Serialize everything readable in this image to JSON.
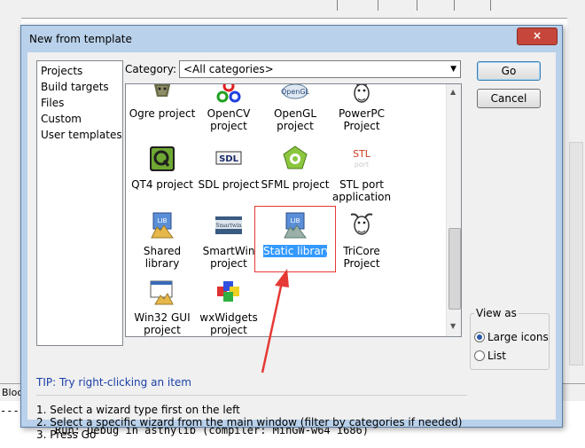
{
  "dialog": {
    "title": "New from template",
    "close": "×"
  },
  "categories_list": [
    "Projects",
    "Build targets",
    "Files",
    "Custom",
    "User templates"
  ],
  "category": {
    "label": "Category:",
    "selected": "<All categories>"
  },
  "templates": [
    {
      "icon": "ogre-icon",
      "label": [
        "Ogre project"
      ]
    },
    {
      "icon": "opencv-icon",
      "label": [
        "OpenCV",
        "project"
      ]
    },
    {
      "icon": "opengl-icon",
      "label": [
        "OpenGL",
        "project"
      ]
    },
    {
      "icon": "powerpc-icon",
      "label": [
        "PowerPC",
        "Project"
      ]
    },
    {
      "icon": "qt-icon",
      "label": [
        "QT4 project"
      ]
    },
    {
      "icon": "sdl-icon",
      "label": [
        "SDL project"
      ]
    },
    {
      "icon": "sfml-icon",
      "label": [
        "SFML project"
      ]
    },
    {
      "icon": "stl-icon",
      "label": [
        "STL port",
        "application"
      ]
    },
    {
      "icon": "lib-icon",
      "label": [
        "Shared",
        "library"
      ]
    },
    {
      "icon": "smartwin-icon",
      "label": [
        "SmartWin",
        "project"
      ]
    },
    {
      "icon": "lib-icon",
      "label": [
        "Static library"
      ],
      "selected": true
    },
    {
      "icon": "gnu-icon",
      "label": [
        "TriCore",
        "Project"
      ]
    },
    {
      "icon": "win32-icon",
      "label": [
        "Win32 GUI",
        "project"
      ]
    },
    {
      "icon": "wxwidgets-icon",
      "label": [
        "wxWidgets",
        "project"
      ]
    }
  ],
  "tip": "TIP: Try right-clicking an item",
  "instructions": [
    "1. Select a wizard type first on the left",
    "2. Select a specific wizard from the main window (filter by categories if needed)",
    "3. Press Go"
  ],
  "buttons": {
    "go": "Go",
    "cancel": "Cancel"
  },
  "view_as": {
    "legend": "View as",
    "options": [
      {
        "label": "Large icons",
        "checked": true
      },
      {
        "label": "List",
        "checked": false
      }
    ]
  },
  "background": {
    "tab_label": "Bloc",
    "log_prefix": "------------",
    "log_line": "Run: Debug in asthylib (compiler: MinGW-w64 i686)"
  },
  "colors": {
    "accent": "#3399ff",
    "annotation": "#e53935",
    "tip": "#1a3ea8"
  }
}
